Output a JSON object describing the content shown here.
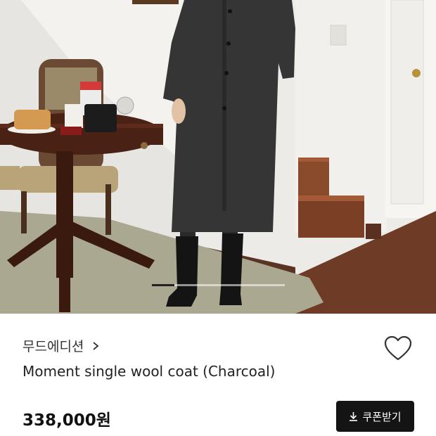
{
  "product": {
    "brand": "무드에디션",
    "brand_chevron_icon": "chevron-right-icon",
    "title": "Moment single wool coat (Charcoal)",
    "price": "338,000원",
    "wishlist_icon": "heart-outline-icon",
    "coupon_label": "쿠폰받기",
    "coupon_icon": "download-icon"
  },
  "gallery": {
    "image_subject": "Model wearing charcoal wool coat with black boots beside wooden table and staircase",
    "progress": 0.17
  },
  "colors": {
    "coupon_bg": "#141414",
    "price_text": "#111111",
    "coat": "#353535"
  }
}
